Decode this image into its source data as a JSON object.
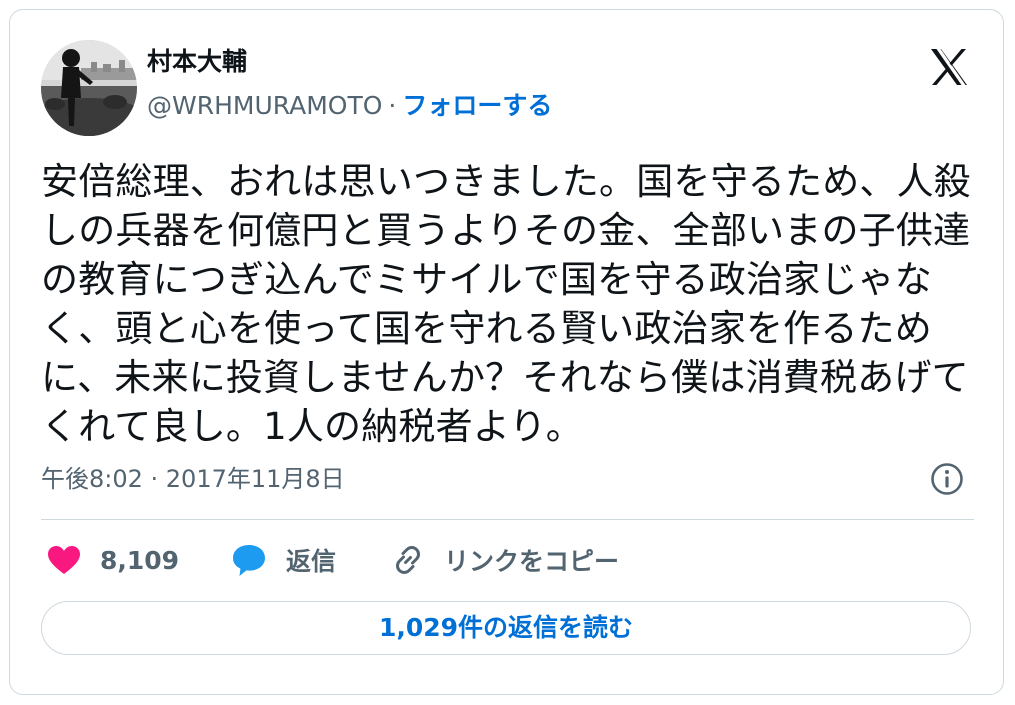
{
  "author": {
    "display_name": "村本大輔",
    "handle": "@WRHMURAMOTO",
    "separator": "·",
    "follow_label": "フォローする"
  },
  "tweet": {
    "text": "安倍総理、おれは思いつきました。国を守るため、人殺しの兵器を何億円と買うよりその金、全部いまの子供達の教育につぎ込んでミサイルで国を守る政治家じゃなく、頭と心を使って国を守れる賢い政治家を作るために、未来に投資しませんか？それなら僕は消費税あげてくれて良し。1人の納税者より。",
    "timestamp": "午後8:02 · 2017年11月8日"
  },
  "actions": {
    "like_count": "8,109",
    "reply_label": "返信",
    "copy_link_label": "リンクをコピー"
  },
  "read_replies_label": "1,029件の返信を読む",
  "icons": {
    "brand": "x-logo-icon",
    "info": "info-icon",
    "like": "heart-icon",
    "reply": "speech-bubble-icon",
    "copy": "link-icon"
  },
  "colors": {
    "like": "#f91880",
    "reply": "#1d9bf0",
    "link": "#006fd6",
    "secondary_text": "#536471",
    "border": "#cfd9de"
  }
}
